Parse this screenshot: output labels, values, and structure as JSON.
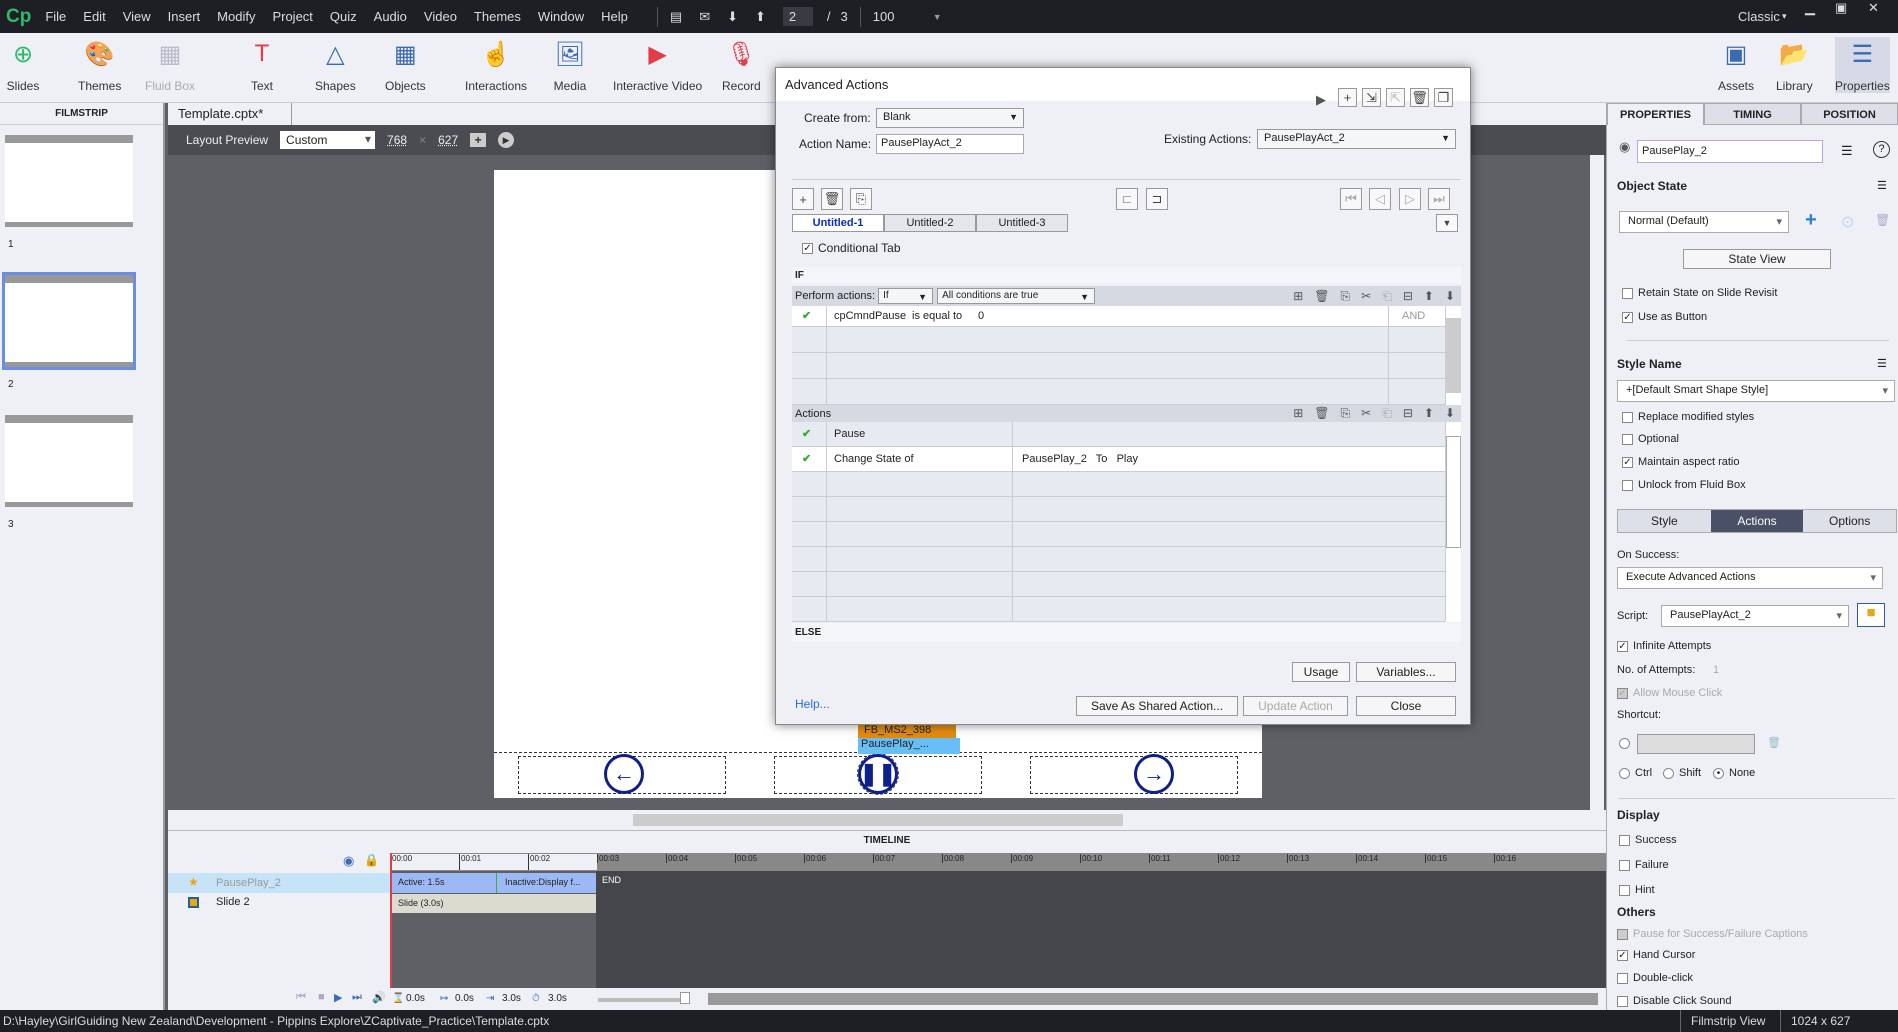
{
  "app": {
    "logo": "Cp",
    "workspace": "Classic",
    "menu": [
      "File",
      "Edit",
      "View",
      "Insert",
      "Modify",
      "Project",
      "Quiz",
      "Audio",
      "Video",
      "Themes",
      "Window",
      "Help"
    ],
    "slide_current": "2",
    "slide_sep": "/",
    "slide_total": "3",
    "zoom": "100"
  },
  "toolbar": [
    {
      "label": "Slides",
      "icon": "add-slide-icon"
    },
    {
      "label": "Themes",
      "icon": "palette-icon"
    },
    {
      "label": "Fluid Box",
      "icon": "fluid-box-icon",
      "disabled": true
    },
    {
      "label": "Text",
      "icon": "text-icon"
    },
    {
      "label": "Shapes",
      "icon": "shapes-icon"
    },
    {
      "label": "Objects",
      "icon": "objects-icon"
    },
    {
      "label": "Interactions",
      "icon": "hand-icon"
    },
    {
      "label": "Media",
      "icon": "image-icon"
    },
    {
      "label": "Interactive Video",
      "icon": "video-icon"
    },
    {
      "label": "Record",
      "icon": "microphone-icon"
    }
  ],
  "toolbar_right": [
    {
      "label": "Assets"
    },
    {
      "label": "Library"
    },
    {
      "label": "Properties"
    }
  ],
  "filmstrip": {
    "header": "FILMSTRIP",
    "slides": [
      "1",
      "2",
      "3"
    ],
    "selected": "2"
  },
  "document": {
    "tab": "Template.cptx*",
    "close": "x",
    "layout_label": "Layout Preview",
    "layout_value": "Custom",
    "width": "768",
    "height": "627",
    "times": "×"
  },
  "stage": {
    "labels": [
      "FB_MS2_398",
      "PausePlay_..."
    ]
  },
  "dialog": {
    "title": "Advanced Actions",
    "create_from_label": "Create from:",
    "create_from": "Blank",
    "action_name_label": "Action Name:",
    "action_name": "PausePlayAct_2",
    "existing_label": "Existing Actions:",
    "existing": "PausePlayAct_2",
    "tabs": [
      "Untitled-1",
      "Untitled-2",
      "Untitled-3"
    ],
    "conditional_tab": "Conditional Tab",
    "if_label": "IF",
    "perform_label": "Perform actions:",
    "perform_value": "If",
    "conditions_value": "All conditions are true",
    "conditions": [
      {
        "variable": "cpCmndPause",
        "operator": "is equal to",
        "value": "0",
        "logic": "AND"
      }
    ],
    "actions_label": "Actions",
    "actions": [
      {
        "action": "Pause",
        "target": ""
      },
      {
        "action": "Change State of",
        "target": "PausePlay_2   To   Play"
      }
    ],
    "else_label": "ELSE",
    "usage": "Usage",
    "variables": "Variables...",
    "help": "Help...",
    "save_shared": "Save As Shared Action...",
    "update": "Update Action",
    "close": "Close"
  },
  "timeline": {
    "title": "TIMELINE",
    "ticks": [
      "00:00",
      "00:01",
      "00:02",
      "00:03",
      "00:04",
      "00:05",
      "00:06",
      "00:07",
      "00:08",
      "00:09",
      "00:10",
      "00:11",
      "00:12",
      "00:13",
      "00:14",
      "00:15",
      "00:16"
    ],
    "layers": [
      {
        "name": "PausePlay_2",
        "active": "Active: 1.5s",
        "inactive": "Inactive:Display f...",
        "end": "END"
      },
      {
        "name": "Slide 2",
        "bar": "Slide (3.0s)"
      }
    ],
    "readouts": [
      "0.0s",
      "0.0s",
      "3.0s",
      "3.0s"
    ]
  },
  "properties": {
    "tabs": [
      "PROPERTIES",
      "TIMING",
      "POSITION"
    ],
    "object_name": "PausePlay_2",
    "object_state_label": "Object State",
    "state": "Normal (Default)",
    "state_view": "State View",
    "retain_state": "Retain State on Slide Revisit",
    "use_as_button": "Use as Button",
    "style_name_label": "Style Name",
    "style": "+[Default Smart Shape Style]",
    "replace_styles": "Replace modified styles",
    "optional": "Optional",
    "maintain_aspect": "Maintain aspect ratio",
    "unlock_fluid": "Unlock from Fluid Box",
    "subtabs": [
      "Style",
      "Actions",
      "Options"
    ],
    "on_success_label": "On Success:",
    "on_success": "Execute Advanced Actions",
    "script_label": "Script:",
    "script": "PausePlayAct_2",
    "infinite_attempts": "Infinite Attempts",
    "attempts_label": "No. of Attempts:",
    "attempts": "1",
    "allow_mouse": "Allow Mouse Click",
    "shortcut_label": "Shortcut:",
    "ctrl": "Ctrl",
    "shift": "Shift",
    "none": "None",
    "display_label": "Display",
    "success": "Success",
    "failure": "Failure",
    "hint": "Hint",
    "others_label": "Others",
    "pause_captions": "Pause for Success/Failure Captions",
    "hand_cursor": "Hand Cursor",
    "double_click": "Double-click",
    "disable_sound": "Disable Click Sound"
  },
  "status": {
    "path": "D:\\Hayley\\GirlGuiding New Zealand\\Development - Pippins Explore\\ZCaptivate_Practice\\Template.cptx",
    "view": "Filmstrip View",
    "size": "1024 x 627"
  },
  "colors": {
    "accent": "#3c6bb4",
    "dark": "#1e1f24",
    "selected_tab": "#0a2bc4",
    "actions_tab": "#4a5066"
  }
}
